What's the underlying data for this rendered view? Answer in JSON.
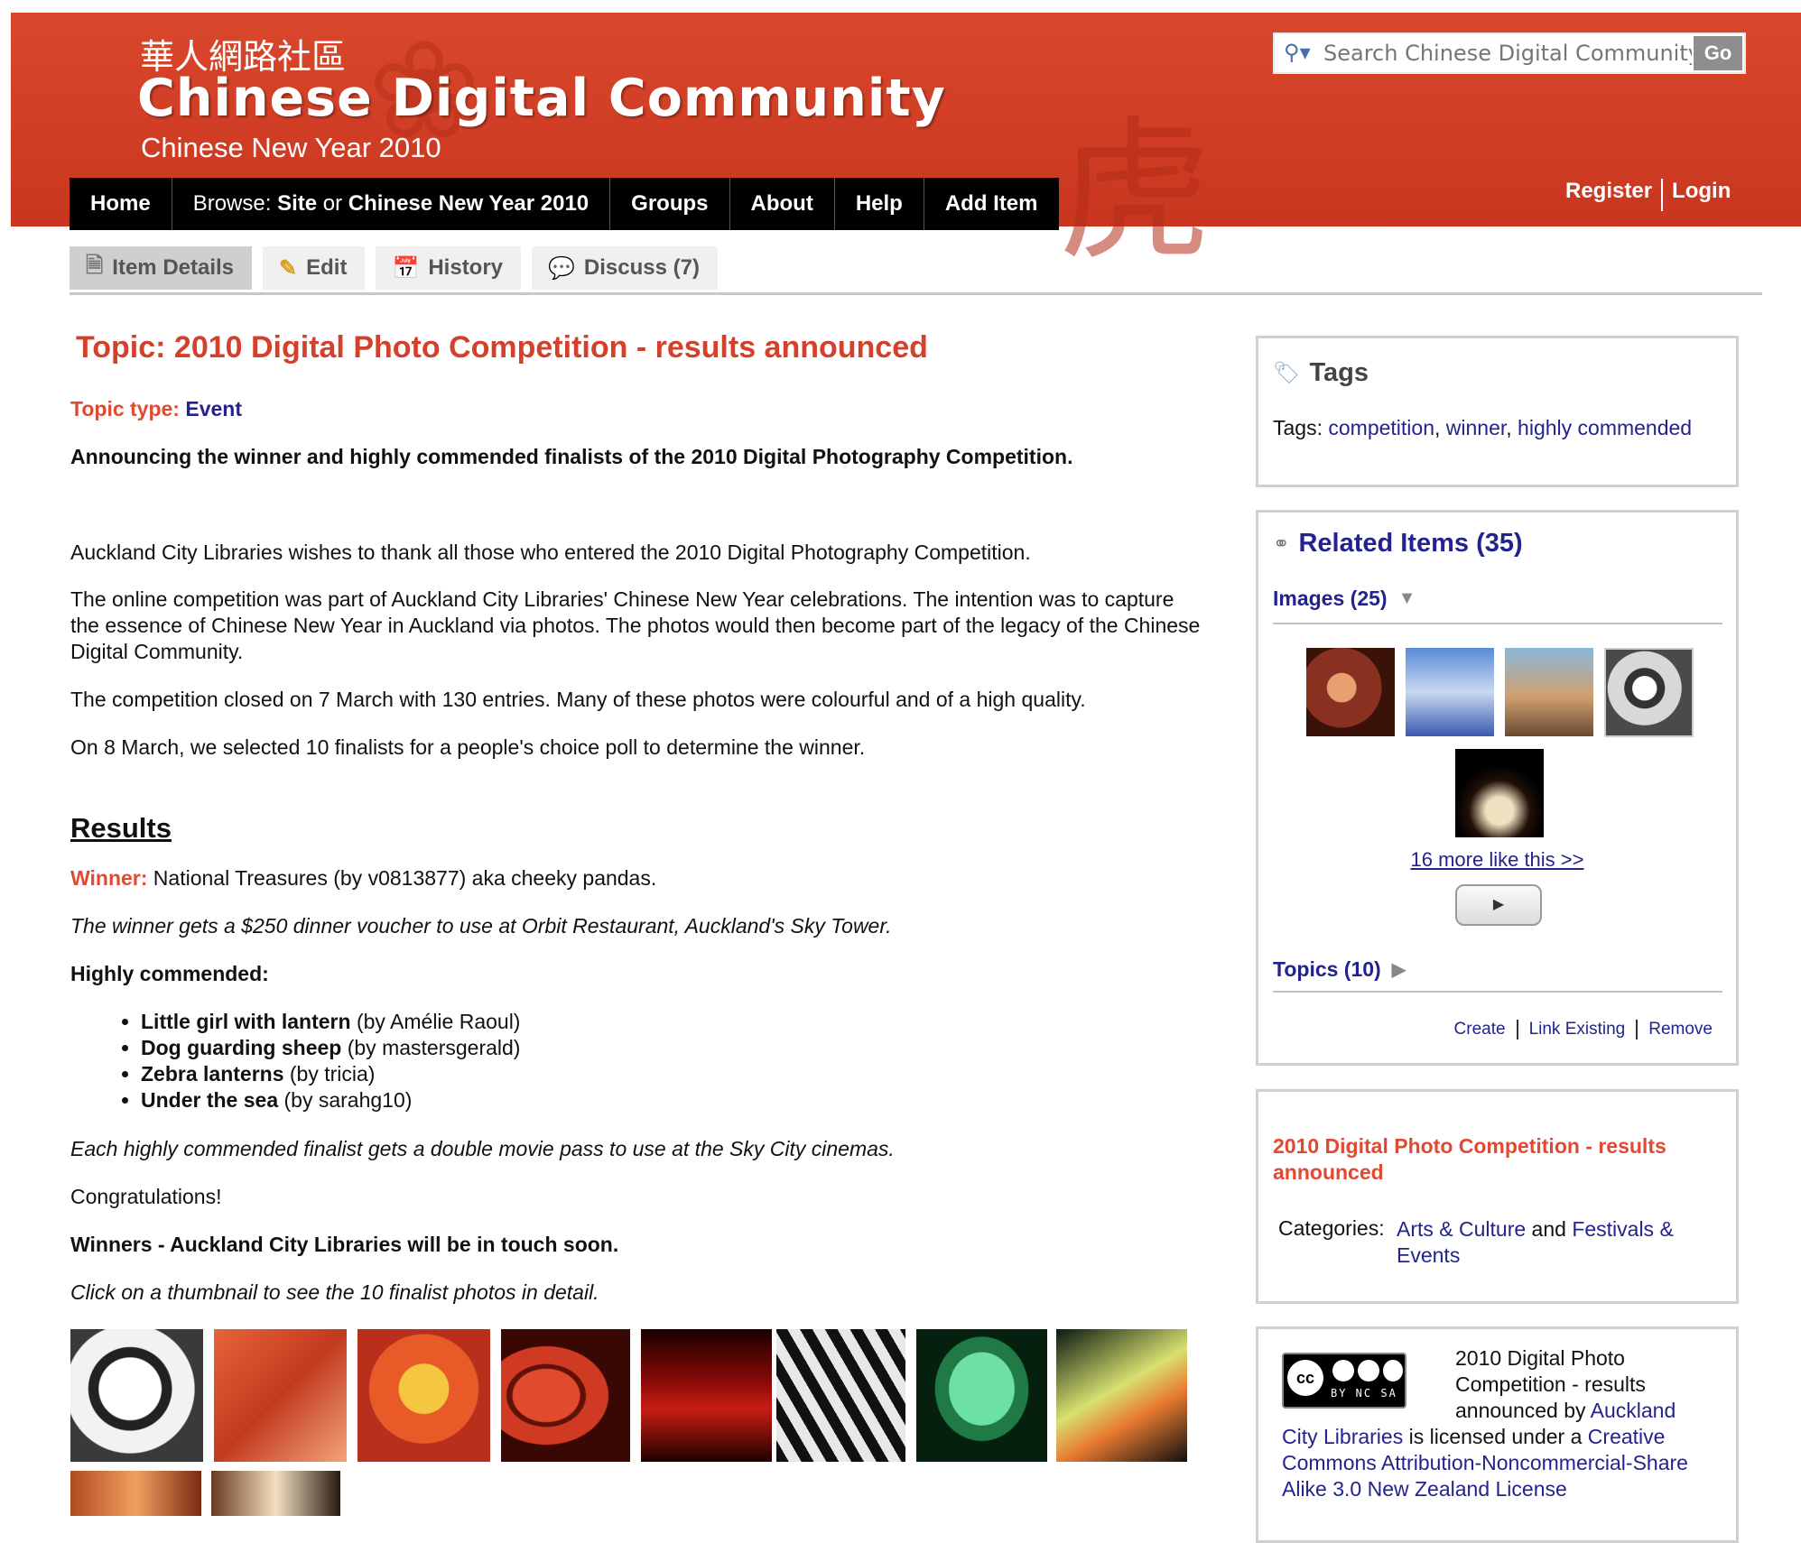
{
  "header": {
    "site_name_cn": "華人網路社區",
    "site_name": "Chinese Digital Community",
    "subtitle": "Chinese New Year 2010",
    "search_placeholder": "Search Chinese Digital Community",
    "search_go": "Go",
    "register": "Register",
    "login": "Login"
  },
  "nav": {
    "home": "Home",
    "browse_prefix": "Browse:",
    "browse_site": "Site",
    "browse_or": "or",
    "browse_cny": "Chinese New Year 2010",
    "groups": "Groups",
    "about": "About",
    "help": "Help",
    "add_item": "Add Item"
  },
  "tabs": {
    "item_details": "Item Details",
    "edit": "Edit",
    "history": "History",
    "discuss": "Discuss (7)"
  },
  "article": {
    "title": "Topic: 2010 Digital Photo Competition - results announced",
    "topic_type_label": "Topic type:",
    "topic_type_value": "Event",
    "summary": "Announcing the winner and highly commended finalists of the 2010 Digital Photography Competition.",
    "para1": "Auckland City Libraries wishes to thank all those who entered the 2010 Digital Photography Competition.",
    "para2_line1": "The online competition was part of Auckland City Libraries' Chinese New Year celebrations. The intention was to capture",
    "para2_line2": "the essence of Chinese New Year in Auckland via photos. The photos would then become part of the legacy of the Chinese",
    "para2_line3": "Digital Community.",
    "para3": "The competition closed on 7 March with 130 entries. Many of these photos were colourful and of a high quality.",
    "para4": "On 8 March, we selected 10 finalists for a people's choice poll to determine the winner.",
    "results_heading": "Results",
    "winner_label": "Winner:",
    "winner_text": "National Treasures (by v0813877) aka cheeky pandas.",
    "winner_prize": "The winner gets a $250 dinner voucher to use at Orbit Restaurant, Auckland's Sky Tower.",
    "hc_label": "Highly commended:",
    "hc_items": [
      {
        "title": "Little girl with lantern",
        "by": "(by Amélie Raoul)"
      },
      {
        "title": "Dog guarding sheep",
        "by": "(by mastersgerald)"
      },
      {
        "title": "Zebra lanterns",
        "by": "(by tricia)"
      },
      {
        "title": "Under the sea",
        "by": "(by sarahg10)"
      }
    ],
    "hc_prize": "Each highly commended finalist gets a double movie pass to use at the Sky City cinemas.",
    "congrats": "Congratulations!",
    "winners_note": "Winners - Auckland City Libraries will be in touch soon.",
    "thumb_hint": "Click on a thumbnail to see the 10 finalist photos in detail."
  },
  "sidebar": {
    "tags_heading": "Tags",
    "tags_label": "Tags:",
    "tags": [
      "competition",
      "winner",
      "highly commended"
    ],
    "related_heading": "Related Items (35)",
    "images_label": "Images (25)",
    "more_like_this": "16 more like this >>",
    "topics_label": "Topics (10)",
    "create": "Create",
    "link_existing": "Link Existing",
    "remove": "Remove",
    "item_title": "2010 Digital Photo Competition - results announced",
    "categories_label": "Categories:",
    "category1": "Arts & Culture",
    "categories_and": "and",
    "category2": "Festivals & Events",
    "license_l1": "2010 Digital Photo",
    "license_l2": "Competition - results",
    "license_l3_pre": "announced by",
    "license_owner1": "Auckland",
    "license_owner2": "City Libraries",
    "license_is": "is licensed under a",
    "license_link1": "Creative",
    "license_link2": "Commons Attribution-Noncommercial-Share",
    "license_link3": "Alike 3.0 New Zealand License",
    "cc_badge_text": "BY NC SA"
  },
  "colors": {
    "banner": "#d9472c",
    "accent_red": "#e04a33",
    "link_blue": "#23238e"
  }
}
